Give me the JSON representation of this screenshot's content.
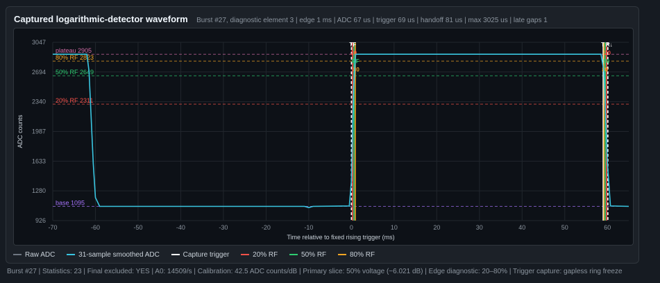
{
  "header": {
    "title": "Captured logarithmic-detector waveform",
    "subtitle": "Burst #27, diagnostic element 3 | edge 1 ms | ADC 67 us | trigger 69 us | handoff 81 us | max 3025 us | late gaps 1"
  },
  "legend": {
    "items": [
      {
        "label": "Raw ADC",
        "color": "#6e7681"
      },
      {
        "label": "31-sample smoothed ADC",
        "color": "#39c5e0"
      },
      {
        "label": "Capture trigger",
        "color": "#ffffff"
      },
      {
        "label": "20% RF",
        "color": "#f85149"
      },
      {
        "label": "50% RF",
        "color": "#2ecc71"
      },
      {
        "label": "80% RF",
        "color": "#f5a623"
      }
    ]
  },
  "footer": {
    "text": "Burst #27 | Statistics: 23 | Final excluded: YES | A0: 14509/s | Calibration: 42.5 ADC counts/dB | Primary slice: 50% voltage (−6.021 dB) | Edge diagnostic: 20–80% | Trigger capture: gapless ring freeze"
  },
  "chart_data": {
    "type": "line",
    "xlabel": "Time relative to fixed rising trigger (ms)",
    "ylabel": "ADC counts",
    "xlim": [
      -70,
      65
    ],
    "ylim": [
      926,
      3047
    ],
    "xticks": [
      -70,
      -60,
      -50,
      -40,
      -30,
      -20,
      -10,
      0,
      10,
      20,
      30,
      40,
      50,
      60
    ],
    "yticks": [
      926,
      1280,
      1633,
      1987,
      2340,
      2694,
      3047
    ],
    "grid": true,
    "series": [
      {
        "name": "Raw ADC",
        "color": "#6e7681",
        "points": [
          [
            -70,
            2905
          ],
          [
            -62,
            2905
          ],
          [
            -61.5,
            2700
          ],
          [
            -60.5,
            1600
          ],
          [
            -60,
            1200
          ],
          [
            -59,
            1095
          ],
          [
            -11,
            1095
          ],
          [
            -10,
            1080
          ],
          [
            -9,
            1095
          ],
          [
            -0.5,
            1100
          ],
          [
            0,
            1400
          ],
          [
            0.5,
            2500
          ],
          [
            1,
            2905
          ],
          [
            58.5,
            2905
          ],
          [
            59.2,
            2700
          ],
          [
            60,
            1600
          ],
          [
            60.7,
            1100
          ],
          [
            65,
            1095
          ]
        ]
      },
      {
        "name": "31-sample smoothed ADC",
        "color": "#39c5e0",
        "points": [
          [
            -70,
            2905
          ],
          [
            -62,
            2905
          ],
          [
            -61.5,
            2700
          ],
          [
            -60.5,
            1600
          ],
          [
            -60,
            1200
          ],
          [
            -59,
            1095
          ],
          [
            -11,
            1095
          ],
          [
            -10,
            1080
          ],
          [
            -9,
            1095
          ],
          [
            -0.5,
            1100
          ],
          [
            0,
            1400
          ],
          [
            0.5,
            2500
          ],
          [
            1,
            2905
          ],
          [
            58.5,
            2905
          ],
          [
            59.2,
            2700
          ],
          [
            60,
            1600
          ],
          [
            60.7,
            1100
          ],
          [
            65,
            1095
          ]
        ]
      }
    ],
    "reference_lines": [
      {
        "label": "plateau 2905",
        "value": 2905,
        "color": "#d16ba5"
      },
      {
        "label": "80% RF 2823",
        "value": 2823,
        "color": "#f5a623"
      },
      {
        "label": "50% RF 2649",
        "value": 2649,
        "color": "#2ecc71"
      },
      {
        "label": "20% RF 2311",
        "value": 2311,
        "color": "#f85149"
      },
      {
        "label": "base 1095",
        "value": 1095,
        "color": "#a371f7"
      }
    ],
    "markers": [
      {
        "x": 0,
        "color": "#ffffff",
        "dashed": true,
        "text": "TF"
      },
      {
        "x": 0.3,
        "color": "#f85149",
        "dashed": false,
        "text": "20"
      },
      {
        "x": 0.6,
        "color": "#2ecc71",
        "dashed": false,
        "text": "RF"
      },
      {
        "x": 0.9,
        "color": "#f5a623",
        "dashed": false,
        "text": "80"
      },
      {
        "x": 59,
        "color": "#ffffff",
        "dashed": false,
        "text": "T"
      },
      {
        "x": 59.2,
        "color": "#f5a623",
        "dashed": false,
        "text": "80"
      },
      {
        "x": 59.5,
        "color": "#2ecc71",
        "dashed": false,
        "text": "50"
      },
      {
        "x": 59.8,
        "color": "#f85149",
        "dashed": false,
        "text": "20"
      },
      {
        "x": 60.1,
        "color": "#ffffff",
        "dashed": true,
        "text": "R↓"
      }
    ]
  }
}
